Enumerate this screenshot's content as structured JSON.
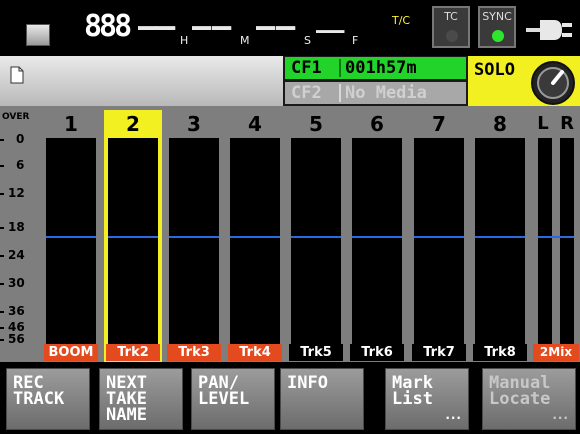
{
  "topbar": {
    "timecode": {
      "hours": "888",
      "minutes_unit": "H",
      "seconds_unit": "M",
      "frames_unit": "S",
      "frames_sub_unit": "F",
      "mode": "T/C"
    },
    "tc_indicator": {
      "label": "TC",
      "led_color": "#4a4a4a"
    },
    "sync_indicator": {
      "label": "SYNC",
      "led_color": "#2ee62e"
    },
    "power_icon": "plug-icon"
  },
  "cards": {
    "cf1": {
      "slot": "CF1",
      "value": "001h57m"
    },
    "cf2": {
      "slot": "CF2",
      "value": "No Media"
    }
  },
  "solo": {
    "label": "SOLO"
  },
  "scale": {
    "labels": [
      "OVER",
      "0",
      "6",
      "12",
      "18",
      "24",
      "30",
      "36",
      "46",
      "56"
    ]
  },
  "channels": [
    {
      "number": "1",
      "name": "BOOM",
      "name_style": "red",
      "selected": false
    },
    {
      "number": "2",
      "name": "Trk2",
      "name_style": "red",
      "selected": true
    },
    {
      "number": "3",
      "name": "Trk3",
      "name_style": "red",
      "selected": false
    },
    {
      "number": "4",
      "name": "Trk4",
      "name_style": "red",
      "selected": false
    },
    {
      "number": "5",
      "name": "Trk5",
      "name_style": "white",
      "selected": false
    },
    {
      "number": "6",
      "name": "Trk6",
      "name_style": "white",
      "selected": false
    },
    {
      "number": "7",
      "name": "Trk7",
      "name_style": "white",
      "selected": false
    },
    {
      "number": "8",
      "name": "Trk8",
      "name_style": "white",
      "selected": false
    }
  ],
  "mix": {
    "left": "L",
    "right": "R",
    "name": "2Mix"
  },
  "buttons": [
    {
      "label": "REC\nTRACK",
      "dots": false,
      "disabled": false
    },
    {
      "label": "NEXT\nTAKE\nNAME",
      "dots": false,
      "disabled": false
    },
    {
      "label": "PAN/\nLEVEL",
      "dots": false,
      "disabled": false
    },
    {
      "label": "INFO",
      "dots": false,
      "disabled": false
    },
    {
      "label": "Mark\nList",
      "dots": true,
      "disabled": false
    },
    {
      "label": "Manual\nLocate",
      "dots": true,
      "disabled": true
    }
  ],
  "colors": {
    "selected_channel": "#f3f021",
    "solo_background": "#f3f021",
    "cf1_background": "#22d42a",
    "name_red": "#e34b1f",
    "reference_line": "#2a6adf"
  }
}
